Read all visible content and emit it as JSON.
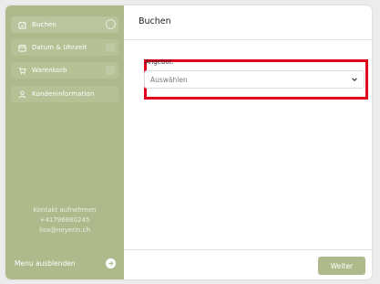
{
  "sidebar": {
    "items": [
      {
        "label": "Buchen",
        "icon": "calendar-check-icon",
        "active": true
      },
      {
        "label": "Datum & Uhrzeit",
        "icon": "calendar-icon",
        "active": false
      },
      {
        "label": "Warenkorb",
        "icon": "cart-icon",
        "active": false
      },
      {
        "label": "Kundeninformation",
        "icon": "person-icon",
        "active": false
      }
    ],
    "contact": {
      "title": "Kontakt aufnehmen",
      "phone": "+41796880245",
      "email": "lisa@neyerin.ch"
    },
    "hide_menu_label": "Menu ausblenden"
  },
  "main": {
    "title": "Buchen",
    "offer_label": "Angebot:",
    "offer_select_value": "Auswählen",
    "next_button_label": "Weiter"
  },
  "colors": {
    "sidebar": "#aeba8b",
    "highlight": "#e0001b",
    "button": "#aeba8b"
  }
}
